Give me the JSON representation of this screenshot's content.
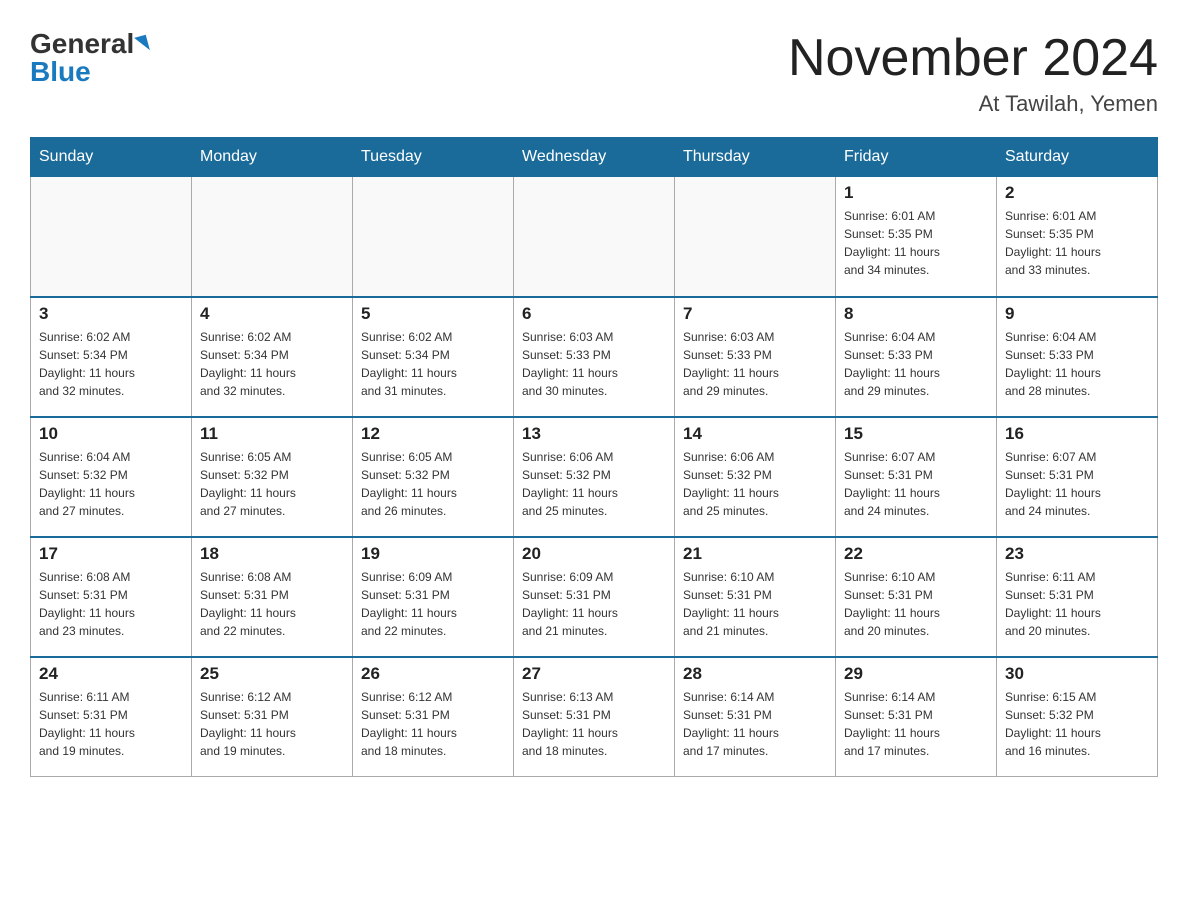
{
  "header": {
    "logo_general": "General",
    "logo_blue": "Blue",
    "month_title": "November 2024",
    "location": "At Tawilah, Yemen"
  },
  "days_of_week": [
    "Sunday",
    "Monday",
    "Tuesday",
    "Wednesday",
    "Thursday",
    "Friday",
    "Saturday"
  ],
  "weeks": [
    {
      "cells": [
        {
          "day": "",
          "info": ""
        },
        {
          "day": "",
          "info": ""
        },
        {
          "day": "",
          "info": ""
        },
        {
          "day": "",
          "info": ""
        },
        {
          "day": "",
          "info": ""
        },
        {
          "day": "1",
          "info": "Sunrise: 6:01 AM\nSunset: 5:35 PM\nDaylight: 11 hours\nand 34 minutes."
        },
        {
          "day": "2",
          "info": "Sunrise: 6:01 AM\nSunset: 5:35 PM\nDaylight: 11 hours\nand 33 minutes."
        }
      ]
    },
    {
      "cells": [
        {
          "day": "3",
          "info": "Sunrise: 6:02 AM\nSunset: 5:34 PM\nDaylight: 11 hours\nand 32 minutes."
        },
        {
          "day": "4",
          "info": "Sunrise: 6:02 AM\nSunset: 5:34 PM\nDaylight: 11 hours\nand 32 minutes."
        },
        {
          "day": "5",
          "info": "Sunrise: 6:02 AM\nSunset: 5:34 PM\nDaylight: 11 hours\nand 31 minutes."
        },
        {
          "day": "6",
          "info": "Sunrise: 6:03 AM\nSunset: 5:33 PM\nDaylight: 11 hours\nand 30 minutes."
        },
        {
          "day": "7",
          "info": "Sunrise: 6:03 AM\nSunset: 5:33 PM\nDaylight: 11 hours\nand 29 minutes."
        },
        {
          "day": "8",
          "info": "Sunrise: 6:04 AM\nSunset: 5:33 PM\nDaylight: 11 hours\nand 29 minutes."
        },
        {
          "day": "9",
          "info": "Sunrise: 6:04 AM\nSunset: 5:33 PM\nDaylight: 11 hours\nand 28 minutes."
        }
      ]
    },
    {
      "cells": [
        {
          "day": "10",
          "info": "Sunrise: 6:04 AM\nSunset: 5:32 PM\nDaylight: 11 hours\nand 27 minutes."
        },
        {
          "day": "11",
          "info": "Sunrise: 6:05 AM\nSunset: 5:32 PM\nDaylight: 11 hours\nand 27 minutes."
        },
        {
          "day": "12",
          "info": "Sunrise: 6:05 AM\nSunset: 5:32 PM\nDaylight: 11 hours\nand 26 minutes."
        },
        {
          "day": "13",
          "info": "Sunrise: 6:06 AM\nSunset: 5:32 PM\nDaylight: 11 hours\nand 25 minutes."
        },
        {
          "day": "14",
          "info": "Sunrise: 6:06 AM\nSunset: 5:32 PM\nDaylight: 11 hours\nand 25 minutes."
        },
        {
          "day": "15",
          "info": "Sunrise: 6:07 AM\nSunset: 5:31 PM\nDaylight: 11 hours\nand 24 minutes."
        },
        {
          "day": "16",
          "info": "Sunrise: 6:07 AM\nSunset: 5:31 PM\nDaylight: 11 hours\nand 24 minutes."
        }
      ]
    },
    {
      "cells": [
        {
          "day": "17",
          "info": "Sunrise: 6:08 AM\nSunset: 5:31 PM\nDaylight: 11 hours\nand 23 minutes."
        },
        {
          "day": "18",
          "info": "Sunrise: 6:08 AM\nSunset: 5:31 PM\nDaylight: 11 hours\nand 22 minutes."
        },
        {
          "day": "19",
          "info": "Sunrise: 6:09 AM\nSunset: 5:31 PM\nDaylight: 11 hours\nand 22 minutes."
        },
        {
          "day": "20",
          "info": "Sunrise: 6:09 AM\nSunset: 5:31 PM\nDaylight: 11 hours\nand 21 minutes."
        },
        {
          "day": "21",
          "info": "Sunrise: 6:10 AM\nSunset: 5:31 PM\nDaylight: 11 hours\nand 21 minutes."
        },
        {
          "day": "22",
          "info": "Sunrise: 6:10 AM\nSunset: 5:31 PM\nDaylight: 11 hours\nand 20 minutes."
        },
        {
          "day": "23",
          "info": "Sunrise: 6:11 AM\nSunset: 5:31 PM\nDaylight: 11 hours\nand 20 minutes."
        }
      ]
    },
    {
      "cells": [
        {
          "day": "24",
          "info": "Sunrise: 6:11 AM\nSunset: 5:31 PM\nDaylight: 11 hours\nand 19 minutes."
        },
        {
          "day": "25",
          "info": "Sunrise: 6:12 AM\nSunset: 5:31 PM\nDaylight: 11 hours\nand 19 minutes."
        },
        {
          "day": "26",
          "info": "Sunrise: 6:12 AM\nSunset: 5:31 PM\nDaylight: 11 hours\nand 18 minutes."
        },
        {
          "day": "27",
          "info": "Sunrise: 6:13 AM\nSunset: 5:31 PM\nDaylight: 11 hours\nand 18 minutes."
        },
        {
          "day": "28",
          "info": "Sunrise: 6:14 AM\nSunset: 5:31 PM\nDaylight: 11 hours\nand 17 minutes."
        },
        {
          "day": "29",
          "info": "Sunrise: 6:14 AM\nSunset: 5:31 PM\nDaylight: 11 hours\nand 17 minutes."
        },
        {
          "day": "30",
          "info": "Sunrise: 6:15 AM\nSunset: 5:32 PM\nDaylight: 11 hours\nand 16 minutes."
        }
      ]
    }
  ]
}
